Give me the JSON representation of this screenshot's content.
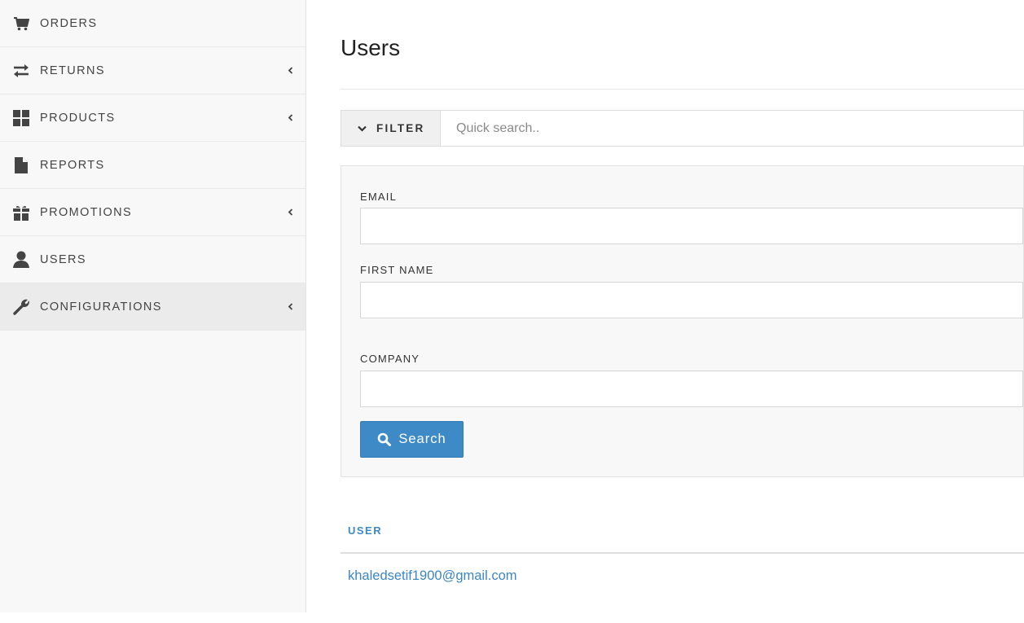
{
  "sidebar": {
    "items": [
      {
        "label": "ORDERS",
        "icon": "cart-icon",
        "has_submenu": false
      },
      {
        "label": "RETURNS",
        "icon": "swap-arrows-icon",
        "has_submenu": true
      },
      {
        "label": "PRODUCTS",
        "icon": "grid-icon",
        "has_submenu": true
      },
      {
        "label": "REPORTS",
        "icon": "document-icon",
        "has_submenu": false
      },
      {
        "label": "PROMOTIONS",
        "icon": "gift-icon",
        "has_submenu": true
      },
      {
        "label": "USERS",
        "icon": "user-icon",
        "has_submenu": false
      },
      {
        "label": "CONFIGURATIONS",
        "icon": "wrench-icon",
        "has_submenu": true,
        "active": true
      }
    ]
  },
  "main": {
    "title": "Users",
    "filter": {
      "toggle_label": "FILTER",
      "quick_search_placeholder": "Quick search..",
      "quick_search_value": ""
    },
    "form": {
      "email_label": "EMAIL",
      "email_value": "",
      "first_name_label": "FIRST NAME",
      "first_name_value": "",
      "company_label": "COMPANY",
      "company_value": "",
      "search_button_label": "Search"
    },
    "table": {
      "columns": [
        "USER"
      ],
      "rows": [
        {
          "user": "khaledsetif1900@gmail.com"
        }
      ]
    }
  },
  "colors": {
    "accent": "#3d8ac7",
    "sidebar_bg": "#f8f8f8",
    "active_item_bg": "#ebebeb"
  }
}
